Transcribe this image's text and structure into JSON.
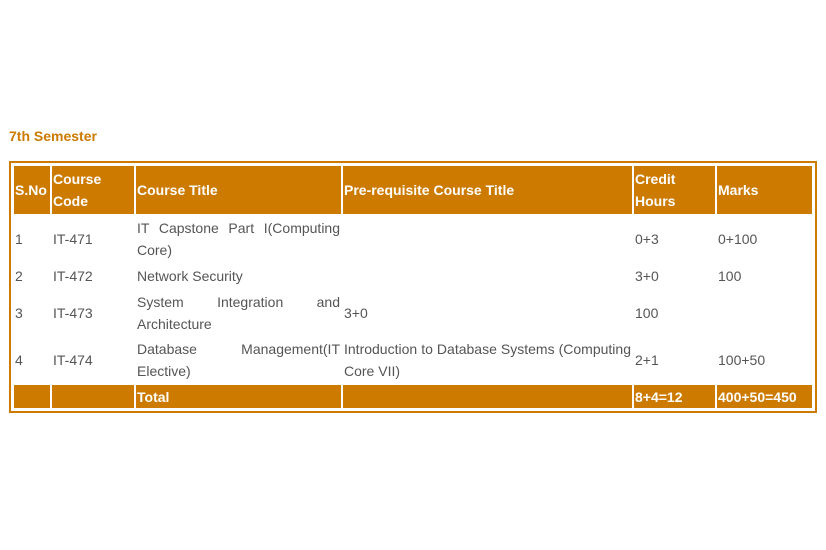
{
  "title": "7th Semester",
  "colors": {
    "accent": "#cc7a00",
    "text": "#555555"
  },
  "headers": [
    "S.No",
    "Course Code",
    "Course Title",
    "Pre-requisite Course Title",
    "Credit Hours",
    "Marks"
  ],
  "rows": [
    [
      "1",
      "IT-471",
      "IT Capstone Part I(Computing Core)",
      "",
      "0+3",
      "0+100"
    ],
    [
      "2",
      "IT-472",
      "Network Security",
      "",
      "3+0",
      "100"
    ],
    [
      "3",
      "IT-473",
      "System Integration and Architecture",
      "3+0",
      "100",
      ""
    ],
    [
      "4",
      "IT-474",
      "Database Management(IT Elective)",
      "Introduction to Database Systems (Computing Core VII)",
      "2+1",
      "100+50"
    ]
  ],
  "total": [
    "",
    "",
    "Total",
    "",
    "8+4=12",
    "400+50=450"
  ]
}
